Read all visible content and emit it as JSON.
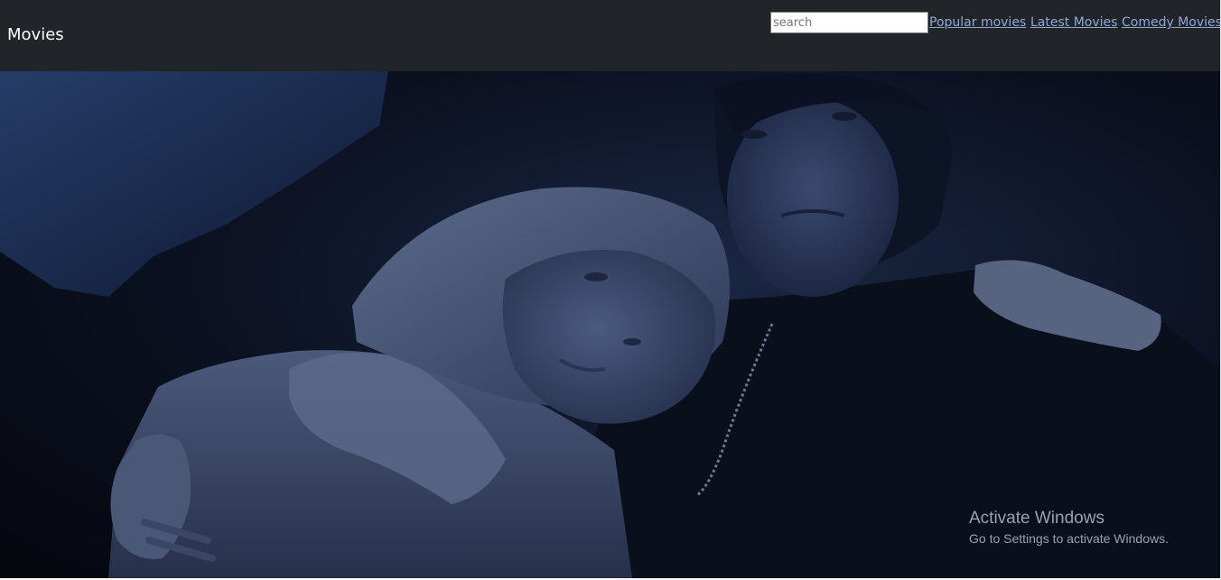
{
  "navbar": {
    "brand": "Movies",
    "search": {
      "placeholder": "search",
      "value": ""
    },
    "links": [
      "Popular movies",
      "Latest Movies",
      "Comedy Movies"
    ]
  },
  "hero": {
    "description": "Dark blue-toned film still of a couple; the woman rests her head on the man's shoulder while he holds her arm"
  },
  "watermark": {
    "title": "Activate Windows",
    "subtitle": "Go to Settings to activate Windows."
  },
  "colors": {
    "navbar_bg": "#212529",
    "link": "#8ea8d6",
    "hero_dark": "#0b1020"
  }
}
